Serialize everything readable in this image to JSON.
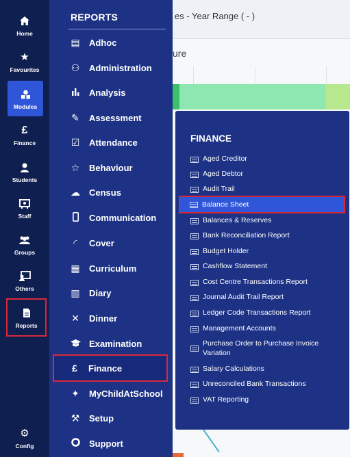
{
  "background": {
    "topbar_text": "es - Year Range ( - )",
    "section_title": "ure"
  },
  "rail": {
    "items": [
      {
        "label": "Home",
        "icon": "home-icon",
        "glyph": "⌂"
      },
      {
        "label": "Favourites",
        "icon": "star-icon",
        "glyph": "★"
      },
      {
        "label": "Modules",
        "icon": "modules-icon",
        "glyph": "▲"
      },
      {
        "label": "Finance",
        "icon": "pound-icon",
        "glyph": "£"
      },
      {
        "label": "Students",
        "icon": "student-icon",
        "glyph": "●"
      },
      {
        "label": "Staff",
        "icon": "staff-icon",
        "glyph": "▣"
      },
      {
        "label": "Groups",
        "icon": "groups-icon",
        "glyph": "●●"
      },
      {
        "label": "Others",
        "icon": "others-icon",
        "glyph": "▤"
      },
      {
        "label": "Reports",
        "icon": "report-icon",
        "glyph": "▤"
      },
      {
        "label": "Config",
        "icon": "gear-icon",
        "glyph": "⚙"
      }
    ]
  },
  "reports": {
    "title": "REPORTS",
    "items": [
      {
        "label": "Adhoc",
        "icon": "document-icon",
        "glyph": "▤"
      },
      {
        "label": "Administration",
        "icon": "people-icon",
        "glyph": "⚇"
      },
      {
        "label": "Analysis",
        "icon": "bar-chart-icon",
        "glyph": "▮"
      },
      {
        "label": "Assessment",
        "icon": "pencil-icon",
        "glyph": "✎"
      },
      {
        "label": "Attendance",
        "icon": "checklist-icon",
        "glyph": "☑"
      },
      {
        "label": "Behaviour",
        "icon": "star-outline-icon",
        "glyph": "☆"
      },
      {
        "label": "Census",
        "icon": "cloud-upload-icon",
        "glyph": "☁"
      },
      {
        "label": "Communication",
        "icon": "phone-icon",
        "glyph": "▯"
      },
      {
        "label": "Cover",
        "icon": "cover-icon",
        "glyph": "◜"
      },
      {
        "label": "Curriculum",
        "icon": "calendar-icon",
        "glyph": "▦"
      },
      {
        "label": "Diary",
        "icon": "book-icon",
        "glyph": "▥"
      },
      {
        "label": "Dinner",
        "icon": "cutlery-icon",
        "glyph": "✕"
      },
      {
        "label": "Examination",
        "icon": "graduation-cap-icon",
        "glyph": "◆"
      },
      {
        "label": "Finance",
        "icon": "pound-icon",
        "glyph": "£"
      },
      {
        "label": "MyChildAtSchool",
        "icon": "child-icon",
        "glyph": "✦"
      },
      {
        "label": "Setup",
        "icon": "wrench-icon",
        "glyph": "⚒"
      },
      {
        "label": "Support",
        "icon": "lifebuoy-icon",
        "glyph": "◯"
      }
    ]
  },
  "finance": {
    "title": "FINANCE",
    "items": [
      "Aged Creditor",
      "Aged Debtor",
      "Audit Trail",
      "Balance Sheet",
      "Balances & Reserves",
      "Bank Reconciliation Report",
      "Budget Holder",
      "Cashflow Statement",
      "Cost Centre Transactions Report",
      "Journal Audit Trail Report",
      "Ledger Code Transactions Report",
      "Management Accounts",
      "Purchase Order to Purchase Invoice Variation",
      "Salary Calculations",
      "Unreconciled Bank Transactions",
      "VAT Reporting"
    ]
  },
  "colors": {
    "rail_bg": "#0f1f4f",
    "panel_bg": "#1d3285",
    "active_blue": "#2f56d9",
    "highlight_red": "#d9283a"
  }
}
